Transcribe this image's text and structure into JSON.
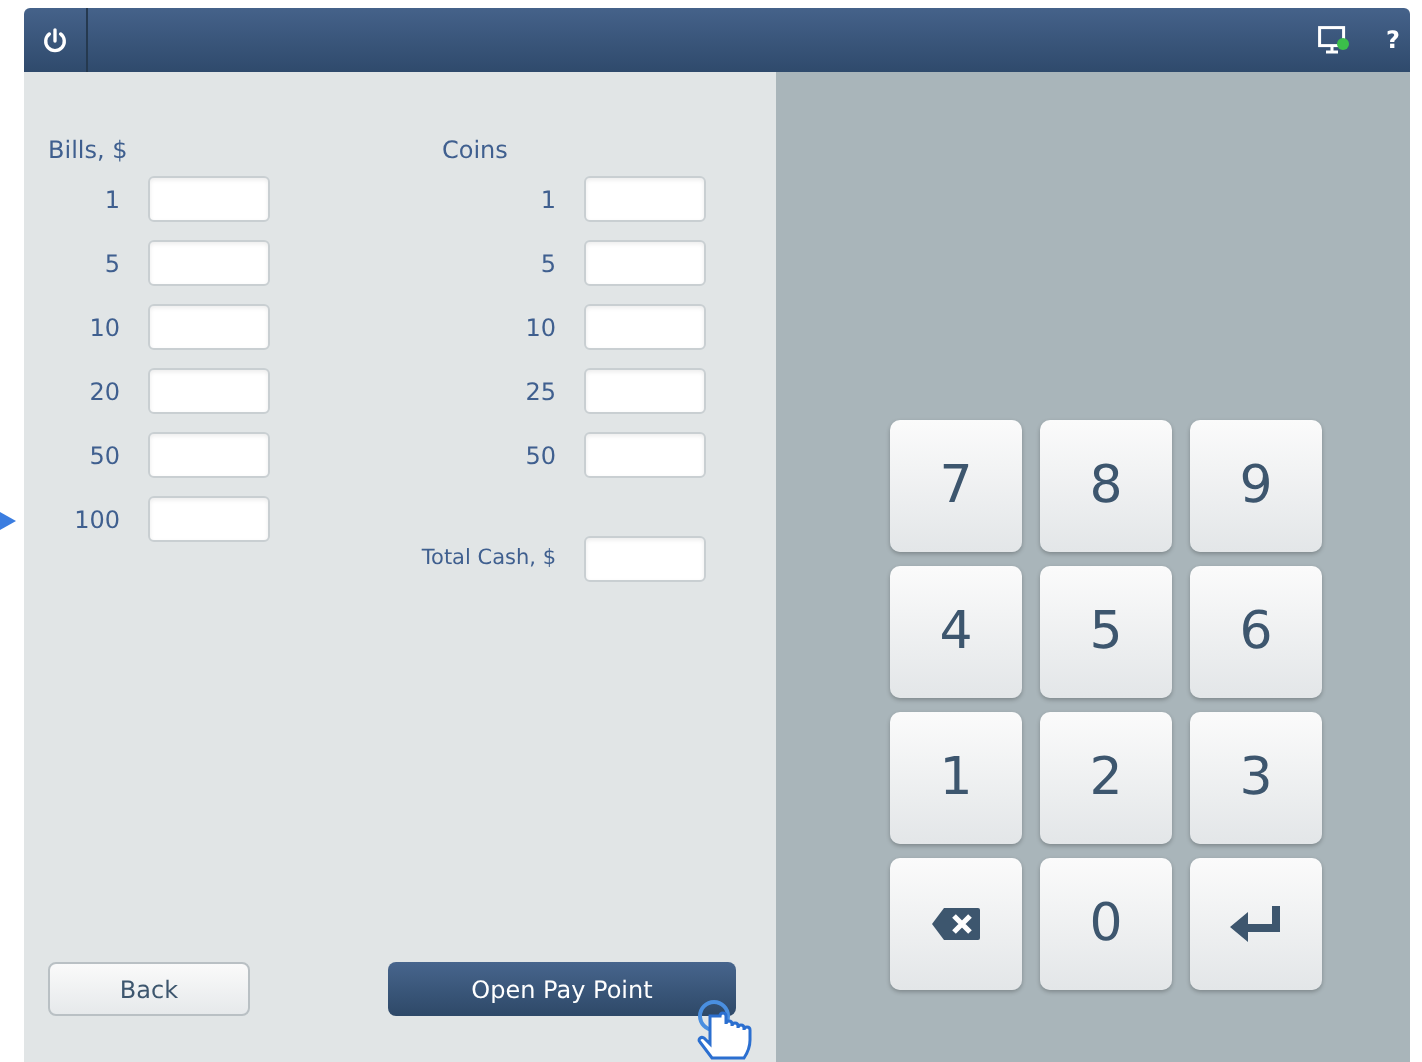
{
  "header": {
    "help": "?"
  },
  "bills": {
    "title": "Bills, $",
    "rows": [
      {
        "label": "1"
      },
      {
        "label": "5"
      },
      {
        "label": "10"
      },
      {
        "label": "20"
      },
      {
        "label": "50"
      },
      {
        "label": "100"
      }
    ]
  },
  "coins": {
    "title": "Coins",
    "rows": [
      {
        "label": "1"
      },
      {
        "label": "5"
      },
      {
        "label": "10"
      },
      {
        "label": "25"
      },
      {
        "label": "50"
      }
    ]
  },
  "total": {
    "label": "Total Cash, $"
  },
  "buttons": {
    "back": "Back",
    "primary": "Open Pay Point"
  },
  "keypad": [
    {
      "kind": "digit",
      "label": "7"
    },
    {
      "kind": "digit",
      "label": "8"
    },
    {
      "kind": "digit",
      "label": "9"
    },
    {
      "kind": "digit",
      "label": "4"
    },
    {
      "kind": "digit",
      "label": "5"
    },
    {
      "kind": "digit",
      "label": "6"
    },
    {
      "kind": "digit",
      "label": "1"
    },
    {
      "kind": "digit",
      "label": "2"
    },
    {
      "kind": "digit",
      "label": "3"
    },
    {
      "kind": "backspace"
    },
    {
      "kind": "digit",
      "label": "0"
    },
    {
      "kind": "enter"
    }
  ]
}
